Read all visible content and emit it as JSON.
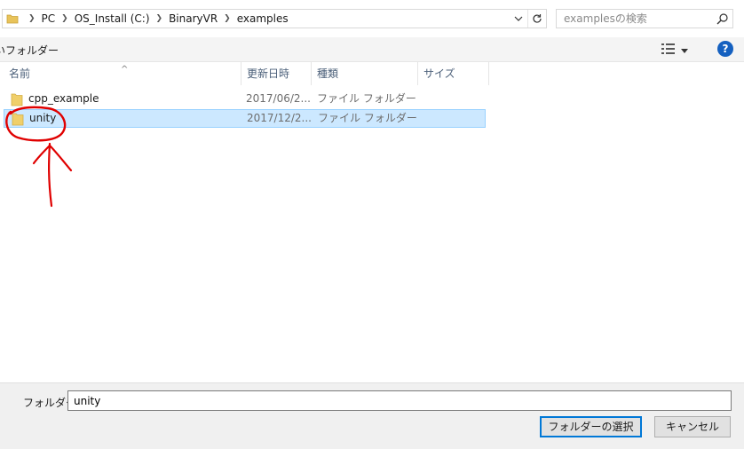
{
  "address_bar": {
    "crumbs": [
      "PC",
      "OS_Install (C:)",
      "BinaryVR",
      "examples"
    ]
  },
  "search": {
    "placeholder": "examplesの検索"
  },
  "toolbar": {
    "new_folder_label": "いフォルダー",
    "help_label": "?"
  },
  "columns": {
    "name": "名前",
    "date": "更新日時",
    "type": "種類",
    "size": "サイズ"
  },
  "files": [
    {
      "name": "cpp_example",
      "date": "2017/06/2...",
      "type": "ファイル フォルダー",
      "selected": false
    },
    {
      "name": "unity",
      "date": "2017/12/2...",
      "type": "ファイル フォルダー",
      "selected": true
    }
  ],
  "bottom": {
    "folder_label": "フォルダー:",
    "folder_value": "unity",
    "select_button": "フォルダーの選択",
    "cancel_button": "キャンセル"
  },
  "colors": {
    "selection": "#cce8ff",
    "selection_border": "#99d1ff",
    "annotation": "#e00000",
    "accent": "#0078d7"
  }
}
